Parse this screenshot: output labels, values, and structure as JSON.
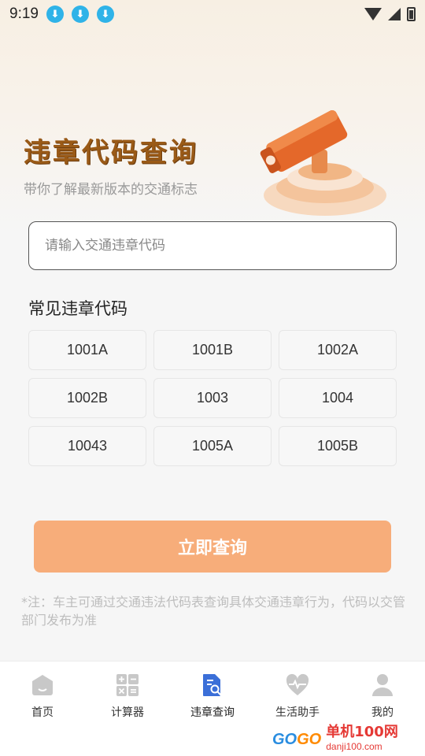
{
  "status_bar": {
    "time": "9:19",
    "download_icons": [
      "download-icon",
      "download-icon",
      "download-icon"
    ]
  },
  "hero": {
    "title": "违章代码查询",
    "subtitle": "带你了解最新版本的交通标志"
  },
  "search": {
    "placeholder": "请输入交通违章代码",
    "value": ""
  },
  "common_codes": {
    "title": "常见违章代码",
    "codes": [
      "1001A",
      "1001B",
      "1002A",
      "1002B",
      "1003",
      "1004",
      "10043",
      "1005A",
      "1005B"
    ]
  },
  "query_button": {
    "label": "立即查询"
  },
  "note": "*注：车主可通过交通违法代码表查询具体交通违章行为，代码以交管部门发布为准",
  "bottom_nav": {
    "items": [
      {
        "label": "首页",
        "icon": "home-icon",
        "active": false
      },
      {
        "label": "计算器",
        "icon": "calculator-icon",
        "active": false
      },
      {
        "label": "违章查询",
        "icon": "document-search-icon",
        "active": true
      },
      {
        "label": "生活助手",
        "icon": "heart-pulse-icon",
        "active": false
      },
      {
        "label": "我的",
        "icon": "user-icon",
        "active": false
      }
    ]
  },
  "watermark": {
    "logo": "GOGO",
    "text": "单机100网",
    "url": "danji100.com"
  },
  "colors": {
    "accent_button": "#f7ad7a",
    "title_brown": "#9a5a17",
    "active_nav": "#3b6fd8",
    "inactive_icon": "#c8c8c8"
  }
}
